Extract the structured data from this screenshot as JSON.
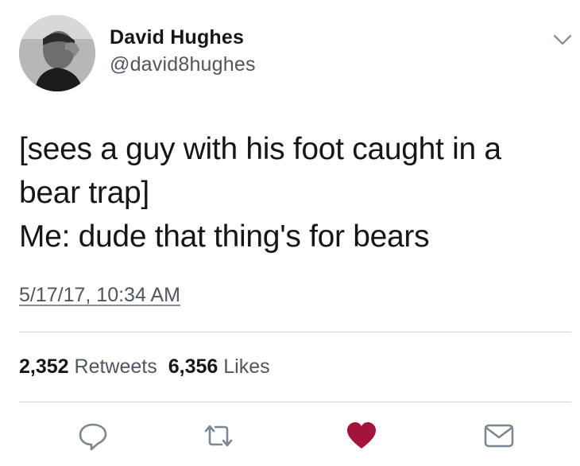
{
  "user": {
    "display_name": "David Hughes",
    "handle": "@david8hughes"
  },
  "tweet": {
    "text_line1": "[sees a guy with his foot caught in a\nbear trap]",
    "text_line2": "Me: dude that thing's for bears",
    "timestamp": "5/17/17, 10:34 AM"
  },
  "stats": {
    "retweets_count": "2,352",
    "retweets_label": "Retweets",
    "likes_count": "6,356",
    "likes_label": "Likes"
  },
  "actions": {
    "reply_icon": "reply-icon",
    "retweet_icon": "retweet-icon",
    "like_icon": "heart-icon",
    "dm_icon": "envelope-icon"
  },
  "colors": {
    "like_active": "#a3143a",
    "icon_gray": "#7d8791",
    "text_primary": "#14171a",
    "text_secondary": "#4f5660"
  }
}
